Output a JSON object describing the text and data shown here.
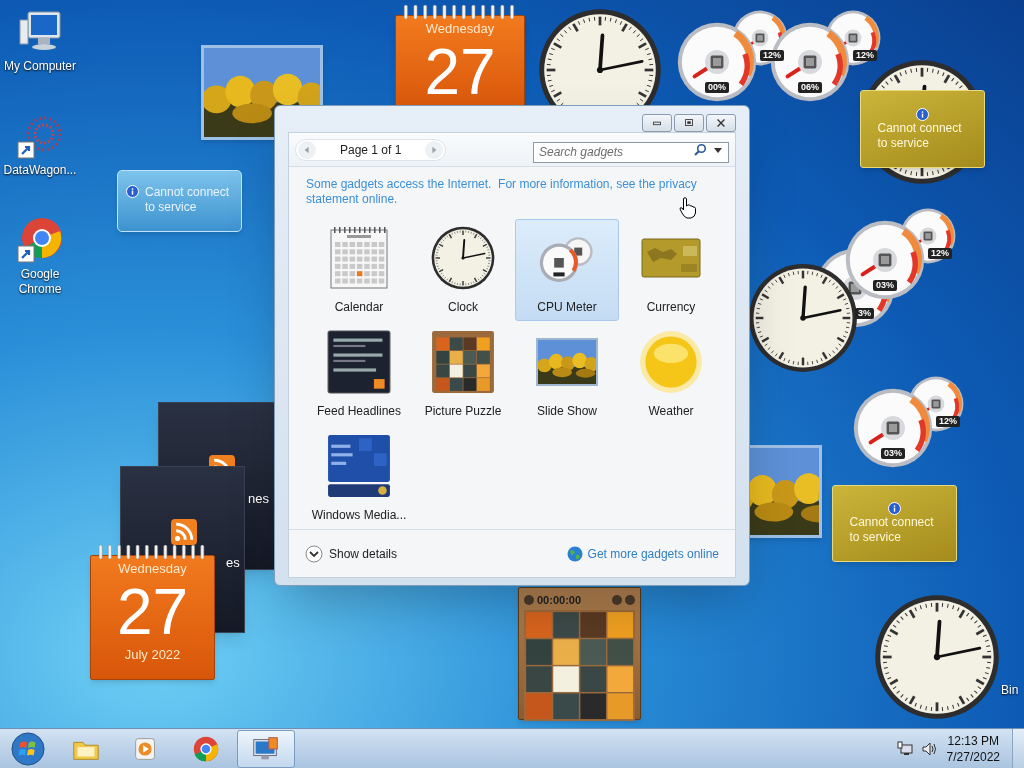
{
  "desktop_icons": [
    {
      "kind": "computer",
      "label": "My Computer"
    },
    {
      "kind": "shortcut",
      "label": "DataWagon..."
    },
    {
      "kind": "chrome",
      "label": "Google Chrome"
    },
    {
      "kind": "covered",
      "label": "Bin"
    }
  ],
  "gadgets": [
    {
      "kind": "slideshow"
    },
    {
      "kind": "calendar",
      "day": "Wednesday",
      "date": "27"
    },
    {
      "kind": "clock"
    },
    {
      "kind": "cpu_meter",
      "cpu": "00%",
      "memory": "12%"
    },
    {
      "kind": "cpu_meter",
      "cpu": "06%",
      "memory": "12%"
    },
    {
      "kind": "clock"
    },
    {
      "kind": "currency",
      "message": "Cannot connect to service"
    },
    {
      "kind": "weather",
      "message": "Cannot connect to service"
    },
    {
      "kind": "cpu_meter",
      "cpu": "3%"
    },
    {
      "kind": "clock"
    },
    {
      "kind": "cpu_meter",
      "cpu": "03%",
      "memory": "12%"
    },
    {
      "kind": "cpu_meter",
      "cpu": "03%",
      "memory": "12%"
    },
    {
      "kind": "slideshow"
    },
    {
      "kind": "currency",
      "message": "Cannot connect to service"
    },
    {
      "kind": "clock"
    },
    {
      "kind": "feed",
      "text": "nes"
    },
    {
      "kind": "feed",
      "text": "es"
    },
    {
      "kind": "calendar",
      "day": "Wednesday",
      "date": "27",
      "month": "July 2022"
    },
    {
      "kind": "puzzle",
      "timer": "00:00:00"
    }
  ],
  "window": {
    "page": "Page 1 of 1",
    "search": {
      "placeholder": "Search gadgets"
    },
    "notice": "Some gadgets access the Internet.  For more information, see the privacy statement online.",
    "items": [
      {
        "kind": "calendar",
        "label": "Calendar",
        "selected": false
      },
      {
        "kind": "clock",
        "label": "Clock",
        "selected": false
      },
      {
        "kind": "cpu_meter",
        "label": "CPU Meter",
        "selected": true
      },
      {
        "kind": "currency",
        "label": "Currency",
        "selected": false
      },
      {
        "kind": "feed",
        "label": "Feed Headlines",
        "selected": false
      },
      {
        "kind": "puzzle",
        "label": "Picture Puzzle",
        "selected": false
      },
      {
        "kind": "slideshow",
        "label": "Slide Show",
        "selected": false
      },
      {
        "kind": "weather",
        "label": "Weather",
        "selected": false
      },
      {
        "kind": "media",
        "label": "Windows Media...",
        "selected": false
      }
    ],
    "details": "Show details",
    "more_link": "Get more gadgets online"
  },
  "taskbar": {
    "apps": [
      {
        "kind": "explorer",
        "active": false
      },
      {
        "kind": "media",
        "active": false
      },
      {
        "kind": "chrome",
        "active": false
      },
      {
        "kind": "gadgets",
        "active": true
      }
    ],
    "time": "12:13 PM",
    "date": "7/27/2022"
  }
}
